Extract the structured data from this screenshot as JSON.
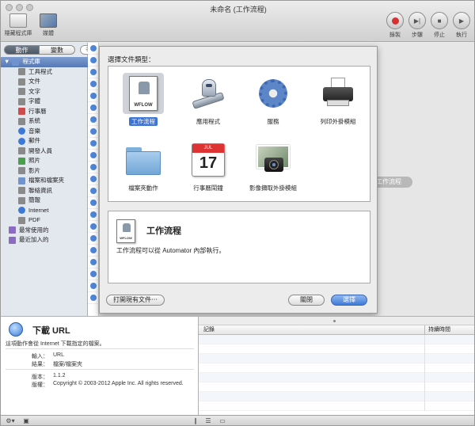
{
  "window": {
    "title": "未命名 (工作流程)"
  },
  "toolbar": {
    "hide_library_label": "隱藏程式庫",
    "media_label": "媒體",
    "record_label": "錄製",
    "step_label": "步驟",
    "stop_label": "停止",
    "run_label": "執行"
  },
  "library": {
    "tab_actions": "動作",
    "tab_variables": "變數",
    "search_placeholder": "名",
    "root": "程式庫",
    "items": [
      "工具程式",
      "文件",
      "文字",
      "字體",
      "行事曆",
      "系統",
      "音樂",
      "郵件",
      "開發人員",
      "照片",
      "影片",
      "檔案和檔案夾",
      "聯絡資訊",
      "簡報",
      "Internet",
      "PDF"
    ],
    "top_items": [
      "最常使用的",
      "最近加入的"
    ]
  },
  "workflow_hint": "工作流程",
  "sheet": {
    "title": "選擇文件類型：",
    "types": [
      "工作流程",
      "應用程式",
      "服務",
      "列印外掛模組",
      "檔案夾動作",
      "行事曆鬧鐘",
      "影像擷取外掛模組"
    ],
    "icon_tag": "WFLOW",
    "calendar_month": "JUL",
    "calendar_day": "17",
    "desc_title": "工作流程",
    "desc_text": "工作流程可以從 Automator 內部執行。",
    "open_existing": "打開現有文件⋯",
    "close": "關閉",
    "choose": "選擇"
  },
  "info": {
    "title": "下載 URL",
    "description": "這項動作會從 Internet 下載指定的檔案。",
    "input_label": "輸入：",
    "input_value": "URL",
    "result_label": "結果：",
    "result_value": "檔案/檔案夾",
    "version_label": "版本：",
    "version_value": "1.1.2",
    "copyright_label": "版權：",
    "copyright_value": "Copyright © 2003-2012 Apple Inc.  All rights reserved."
  },
  "log": {
    "col_log": "記錄",
    "col_duration": "持續時間"
  }
}
